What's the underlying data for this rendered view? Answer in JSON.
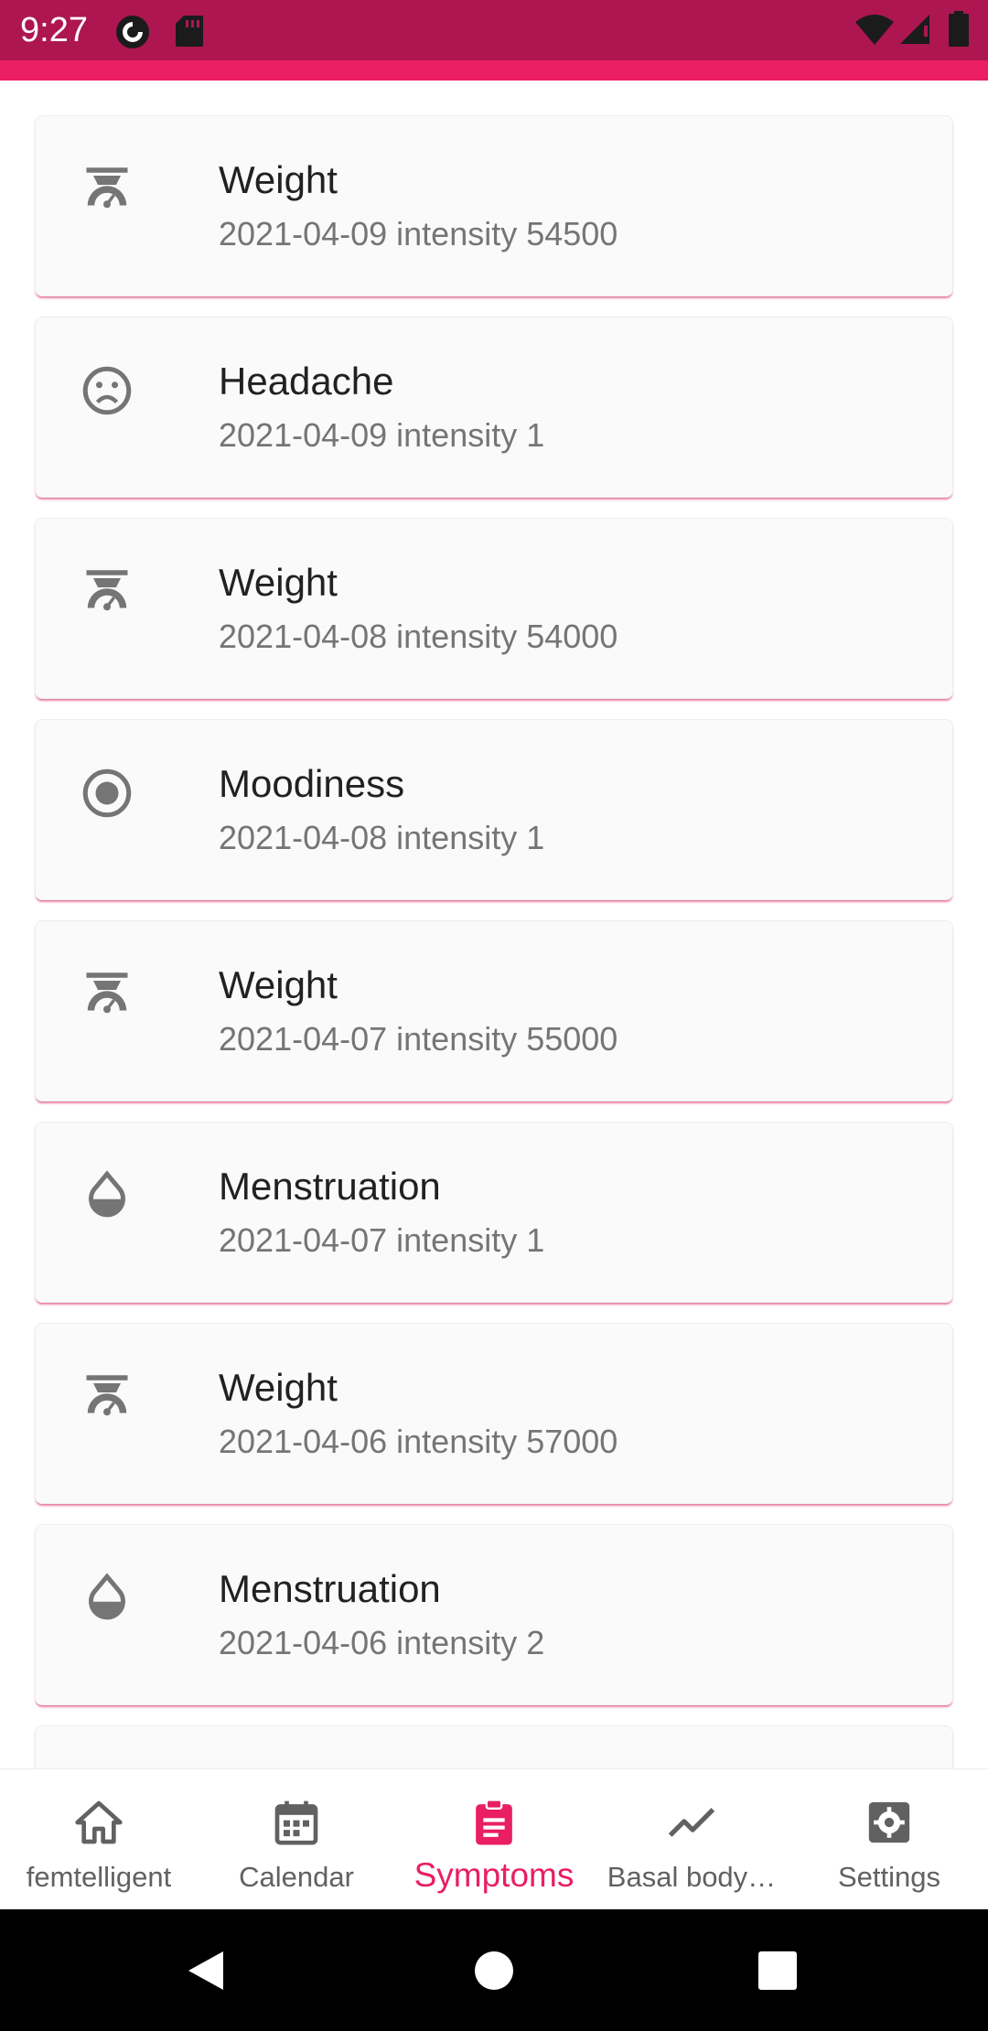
{
  "status_bar": {
    "time": "9:27",
    "left_icons": [
      "pocket-casts-icon",
      "sd-card-icon"
    ],
    "right_icons": [
      "wifi-icon",
      "cell-signal-icon",
      "battery-icon"
    ]
  },
  "colors": {
    "status_bar": "#ad1651",
    "accent": "#e91e63",
    "card_bg": "#fafafa",
    "text_primary": "#212121",
    "text_secondary": "#757575"
  },
  "entries": [
    {
      "icon": "scale-icon",
      "title": "Weight",
      "subtitle": "2021-04-09 intensity 54500"
    },
    {
      "icon": "sad-face-icon",
      "title": "Headache",
      "subtitle": "2021-04-09 intensity 1"
    },
    {
      "icon": "scale-icon",
      "title": "Weight",
      "subtitle": "2021-04-08 intensity 54000"
    },
    {
      "icon": "radio-button-icon",
      "title": "Moodiness",
      "subtitle": "2021-04-08 intensity 1"
    },
    {
      "icon": "scale-icon",
      "title": "Weight",
      "subtitle": "2021-04-07 intensity 55000"
    },
    {
      "icon": "drop-icon",
      "title": "Menstruation",
      "subtitle": "2021-04-07 intensity 1"
    },
    {
      "icon": "scale-icon",
      "title": "Weight",
      "subtitle": "2021-04-06 intensity 57000"
    },
    {
      "icon": "drop-icon",
      "title": "Menstruation",
      "subtitle": "2021-04-06 intensity 2"
    }
  ],
  "bottom_nav": {
    "items": [
      {
        "label": "femtelligent",
        "icon": "home-icon"
      },
      {
        "label": "Calendar",
        "icon": "calendar-icon"
      },
      {
        "label": "Symptoms",
        "icon": "clipboard-icon",
        "active": true
      },
      {
        "label": "Basal body…",
        "icon": "trend-line-icon"
      },
      {
        "label": "Settings",
        "icon": "gear-icon"
      }
    ]
  },
  "system_nav": {
    "buttons": [
      "back-icon",
      "home-circle-icon",
      "recents-icon"
    ]
  }
}
